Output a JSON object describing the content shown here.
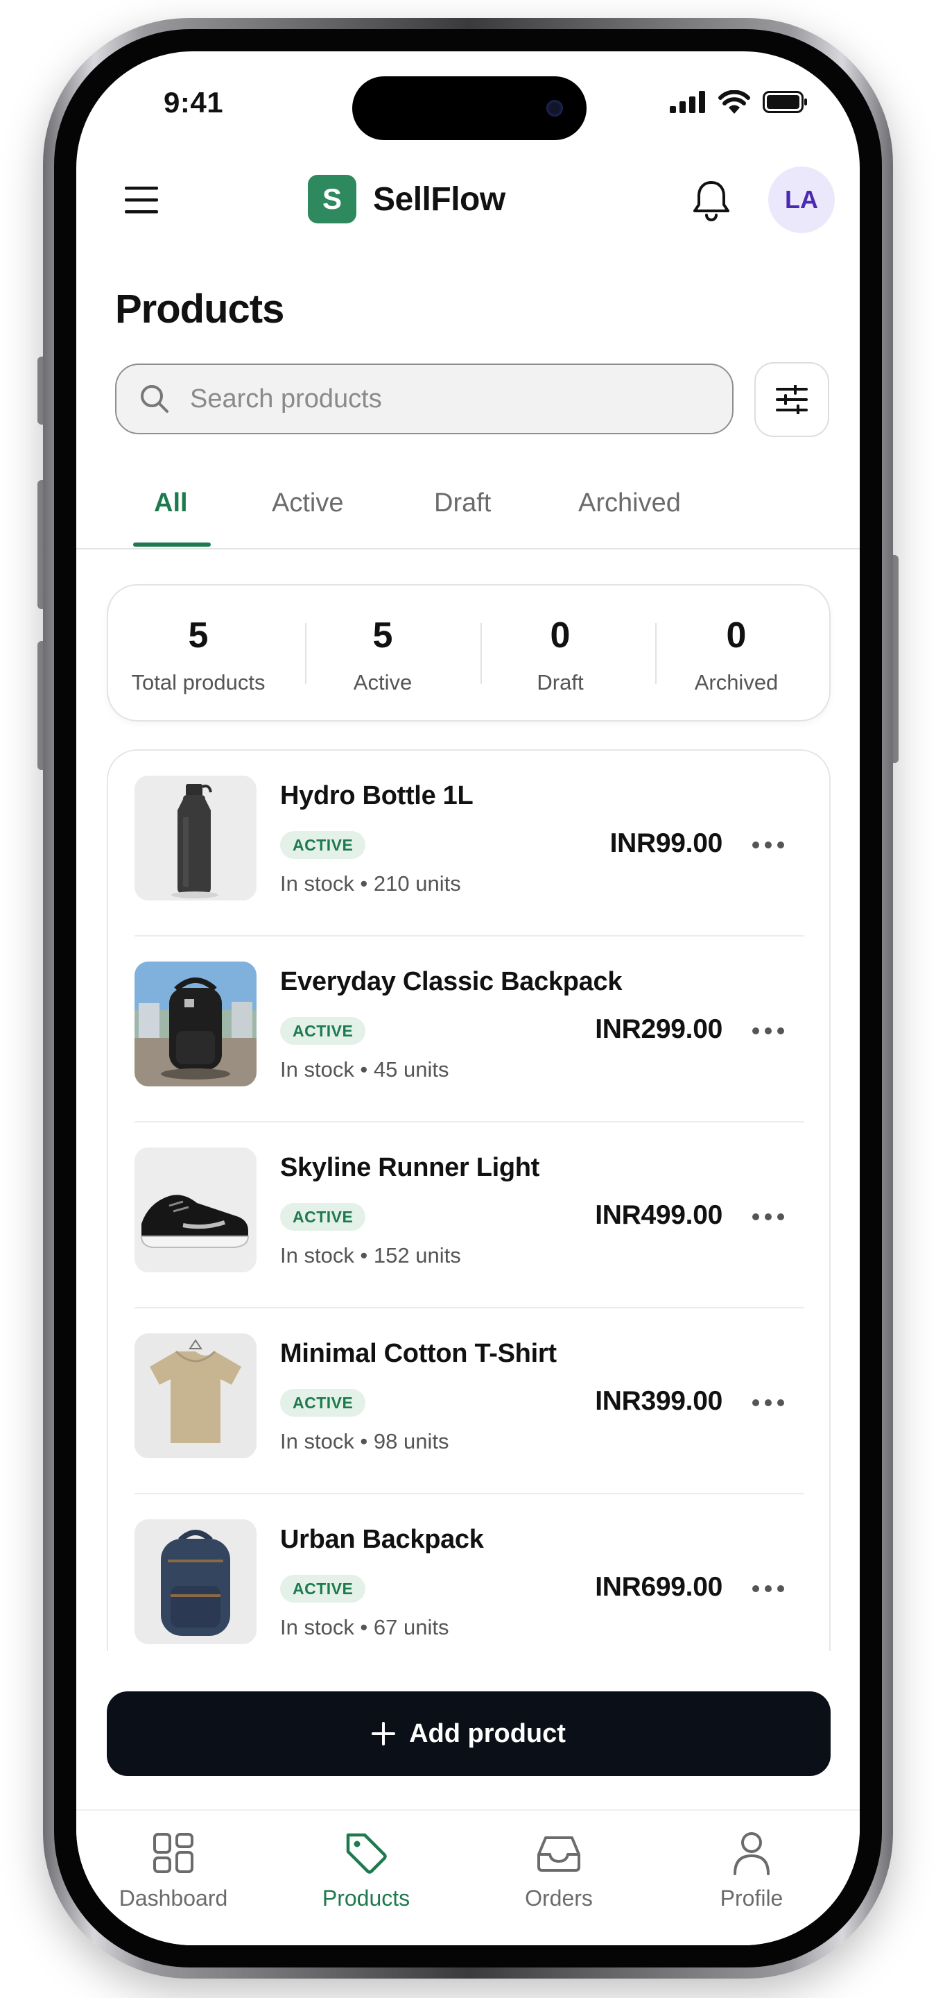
{
  "status_bar": {
    "time": "9:41"
  },
  "header": {
    "brand_initial": "S",
    "brand_name": "SellFlow",
    "avatar_initials": "LA"
  },
  "page": {
    "title": "Products"
  },
  "search": {
    "placeholder": "Search products",
    "value": ""
  },
  "tabs": [
    {
      "label": "All",
      "active": true
    },
    {
      "label": "Active",
      "active": false
    },
    {
      "label": "Draft",
      "active": false
    },
    {
      "label": "Archived",
      "active": false
    }
  ],
  "stats": [
    {
      "value": "5",
      "label": "Total products"
    },
    {
      "value": "5",
      "label": "Active"
    },
    {
      "value": "0",
      "label": "Draft"
    },
    {
      "value": "0",
      "label": "Archived"
    }
  ],
  "products": [
    {
      "name": "Hydro Bottle 1L",
      "status": "ACTIVE",
      "stock": "In stock • 210 units",
      "price": "INR99.00",
      "image": "bottle"
    },
    {
      "name": "Everyday Classic Backpack",
      "status": "ACTIVE",
      "stock": "In stock • 45 units",
      "price": "INR299.00",
      "image": "backpack-black"
    },
    {
      "name": "Skyline Runner Light",
      "status": "ACTIVE",
      "stock": "In stock • 152 units",
      "price": "INR499.00",
      "image": "sneaker"
    },
    {
      "name": "Minimal Cotton T-Shirt",
      "status": "ACTIVE",
      "stock": "In stock • 98 units",
      "price": "INR399.00",
      "image": "tshirt"
    },
    {
      "name": "Urban Backpack",
      "status": "ACTIVE",
      "stock": "In stock • 67 units",
      "price": "INR699.00",
      "image": "backpack-navy"
    }
  ],
  "actions": {
    "add_product_label": "Add product"
  },
  "bottom_nav": [
    {
      "label": "Dashboard",
      "icon": "grid-icon",
      "active": false
    },
    {
      "label": "Products",
      "icon": "tag-icon",
      "active": true
    },
    {
      "label": "Orders",
      "icon": "inbox-icon",
      "active": false
    },
    {
      "label": "Profile",
      "icon": "user-icon",
      "active": false
    }
  ],
  "colors": {
    "accent": "#1e7a4e",
    "brand": "#2e8a5e",
    "badge_bg": "#e3f1e8",
    "avatar_bg": "#ece8fb",
    "avatar_text": "#4a2bb0",
    "primary_button": "#0b0f17"
  }
}
